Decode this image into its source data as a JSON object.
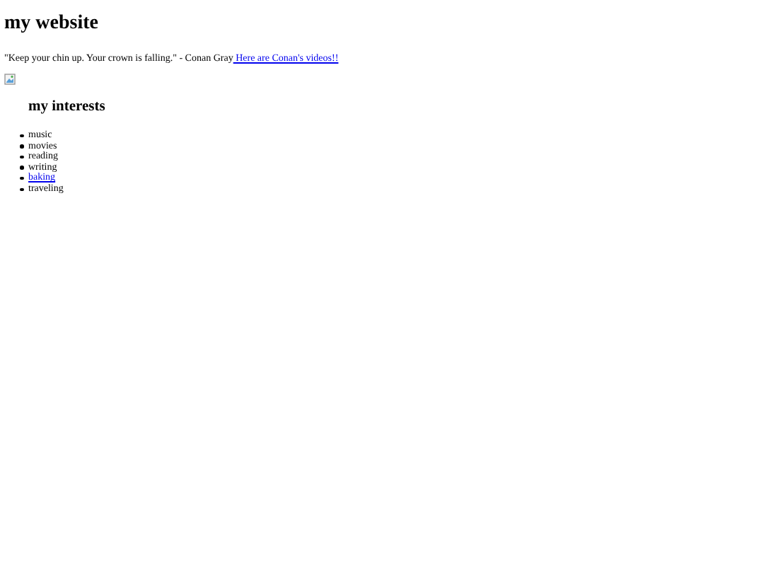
{
  "heading": "my website",
  "quote": {
    "text": "\"Keep your chin up. Your crown is falling.\" - Conan Gray",
    "link": " Here are Conan's videos!!"
  },
  "image": {
    "kind": "broken-image"
  },
  "interests": {
    "heading": "my interests",
    "items": [
      {
        "label": "music",
        "kind": "text"
      },
      {
        "label": "movies",
        "kind": "text"
      },
      {
        "label": "reading",
        "kind": "text"
      },
      {
        "label": "writing",
        "kind": "text"
      },
      {
        "label": "baking",
        "kind": "link"
      },
      {
        "label": "traveling",
        "kind": "text"
      }
    ]
  }
}
